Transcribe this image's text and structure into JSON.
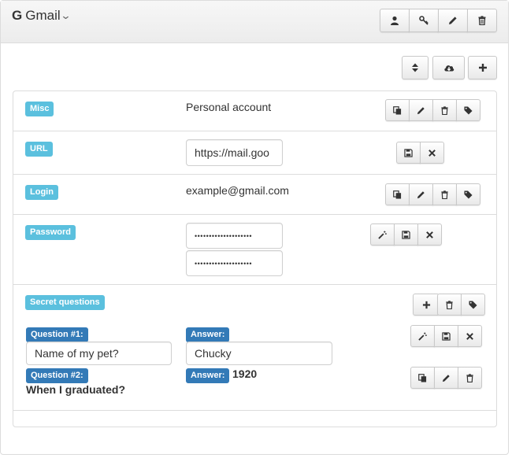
{
  "header": {
    "app_glyph": "G",
    "app_name": "Gmail",
    "actions": [
      "user-icon",
      "key-icon",
      "pencil-icon",
      "trash-icon"
    ]
  },
  "toolbar": {
    "actions": [
      "sort-icon",
      "cloud-download-icon",
      "plus-icon"
    ]
  },
  "fields": {
    "misc": {
      "label": "Misc",
      "value": "Personal account"
    },
    "url": {
      "label": "URL",
      "value": "https://mail.goo"
    },
    "login": {
      "label": "Login",
      "value": "example@gmail.com"
    },
    "password": {
      "label": "Password",
      "value": "••••••••••••••••••••",
      "confirm": "••••••••••••••••••••"
    }
  },
  "secret_questions": {
    "label": "Secret questions",
    "items": [
      {
        "question_label": "Question #1:",
        "question": "Name of my pet?",
        "answer_label": "Answer:",
        "answer": "Chucky",
        "editing": true
      },
      {
        "question_label": "Question #2:",
        "question": "When I graduated?",
        "answer_label": "Answer:",
        "answer": "1920",
        "editing": false
      }
    ]
  },
  "colors": {
    "label_info": "#5bc0de",
    "label_primary": "#337ab7"
  }
}
